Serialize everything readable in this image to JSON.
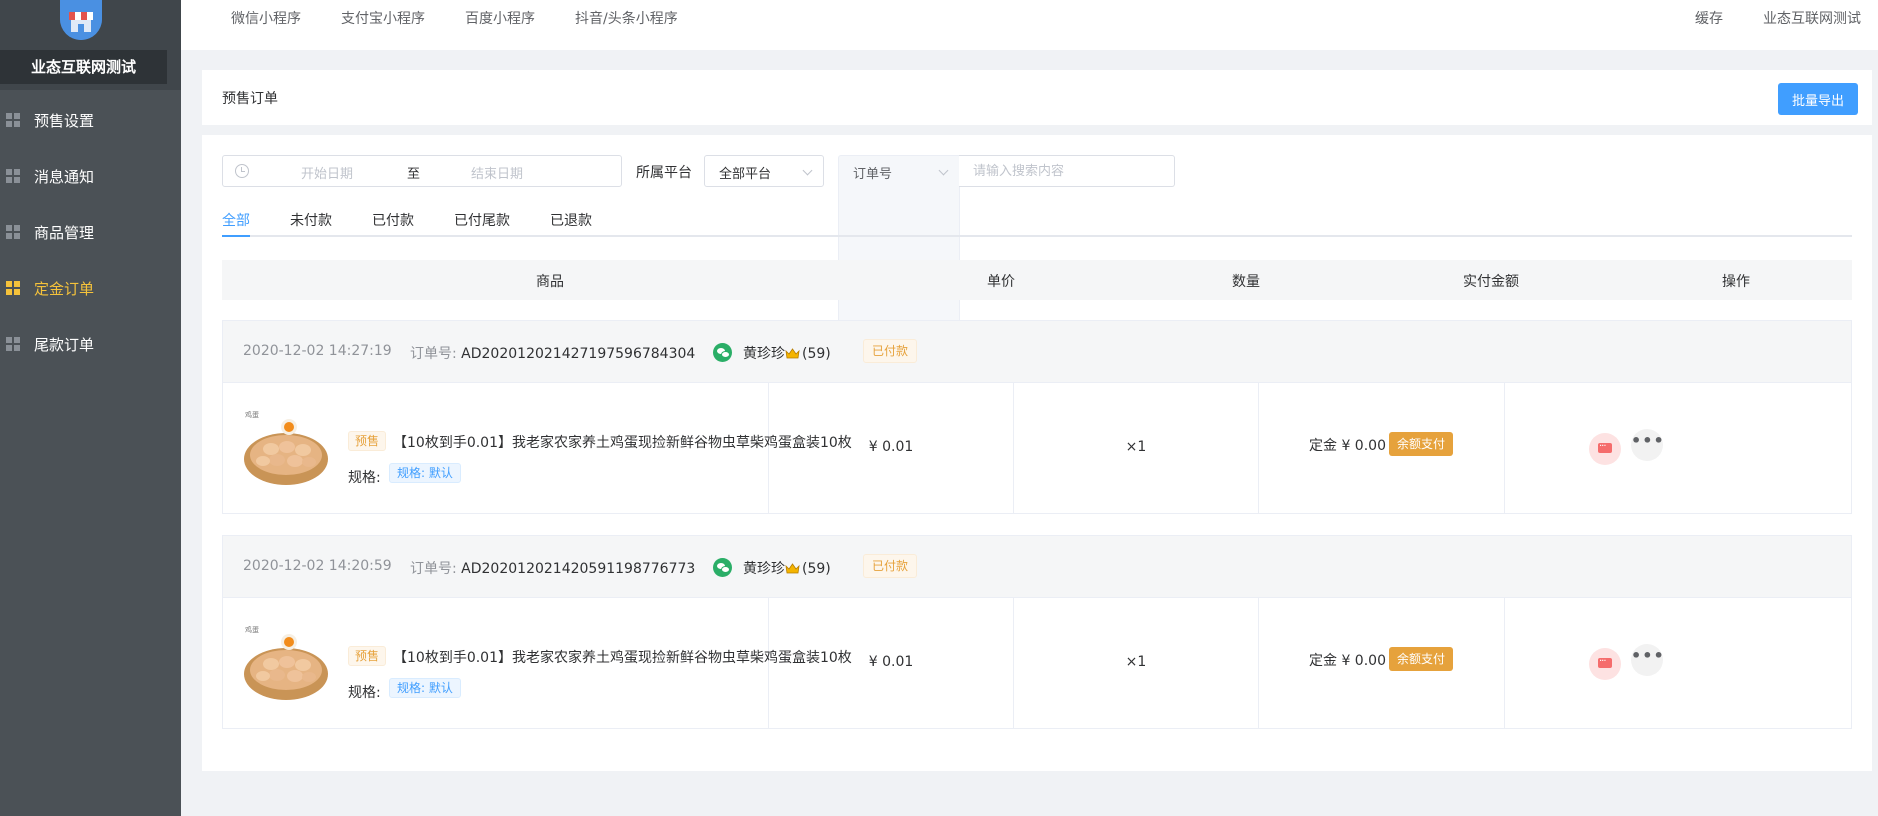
{
  "sidebar": {
    "brand": "业态互联网测试",
    "items": [
      {
        "label": "预售设置",
        "active": false
      },
      {
        "label": "消息通知",
        "active": false
      },
      {
        "label": "商品管理",
        "active": false
      },
      {
        "label": "定金订单",
        "active": true
      },
      {
        "label": "尾款订单",
        "active": false
      }
    ]
  },
  "topbar": {
    "tabs": [
      "微信小程序",
      "支付宝小程序",
      "百度小程序",
      "抖音/头条小程序"
    ],
    "cache": "缓存",
    "account": "业态互联网测试"
  },
  "header": {
    "title": "预售订单",
    "export_label": "批量导出"
  },
  "filters": {
    "start_placeholder": "开始日期",
    "separator": "至",
    "end_placeholder": "结束日期",
    "platform_label": "所属平台",
    "platform_value": "全部平台",
    "search_field": "订单号",
    "search_placeholder": "请输入搜索内容"
  },
  "tabs": {
    "items": [
      "全部",
      "未付款",
      "已付款",
      "已付尾款",
      "已退款"
    ],
    "active": "全部"
  },
  "table": {
    "columns": [
      "商品",
      "单价",
      "数量",
      "实付金额",
      "操作"
    ]
  },
  "orders": [
    {
      "time": "2020-12-02 14:27:19",
      "order_no_label": "订单号:",
      "order_no": "AD20201202142719759678​4304",
      "buyer": "黄珍珍",
      "buyer_level": "(59)",
      "status": "已付款",
      "presale_tag": "预售",
      "goods_name": "【10枚到手0.01】我老家农家养土鸡蛋现捡新鲜谷物虫草柴鸡蛋盒装10枚",
      "spec_label": "规格:",
      "spec": "规格: 默认",
      "price": "¥ 0.01",
      "quantity": "×1",
      "paid_amount": "定金 ¥ 0.00",
      "pay_method": "余额支付"
    },
    {
      "time": "2020-12-02 14:20:59",
      "order_no_label": "订单号:",
      "order_no": "AD2020120214205911987​76773",
      "buyer": "黄珍珍",
      "buyer_level": "(59)",
      "status": "已付款",
      "presale_tag": "预售",
      "goods_name": "【10枚到手0.01】我老家农家养土鸡蛋现捡新鲜谷物虫草柴鸡蛋盒装10枚",
      "spec_label": "规格:",
      "spec": "规格: 默认",
      "price": "¥ 0.01",
      "quantity": "×1",
      "paid_amount": "定金 ¥ 0.00",
      "pay_method": "余额支付"
    }
  ],
  "colors": {
    "sidebar_bg": "#4b5156",
    "active_menu": "#f5c23b",
    "primary": "#409eff",
    "warning": "#e6a23c"
  }
}
